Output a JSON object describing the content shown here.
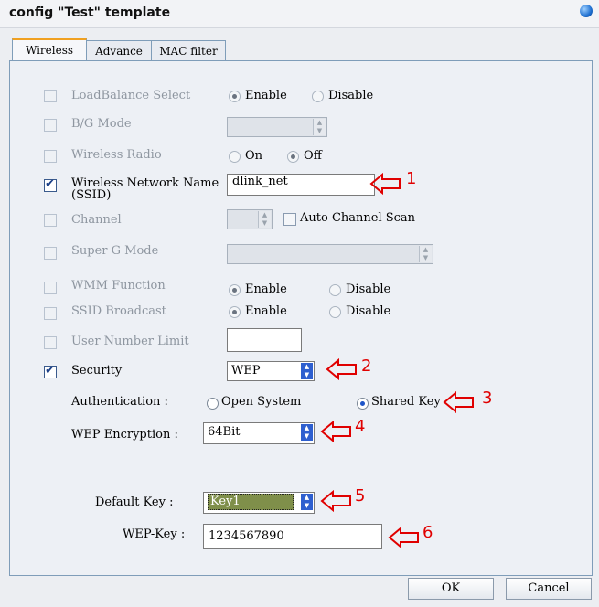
{
  "window": {
    "title": "config \"Test\" template"
  },
  "tabs": [
    "Wireless",
    "Advance",
    "MAC filter"
  ],
  "rows": {
    "load_balance": {
      "label": "LoadBalance Select",
      "opt1": "Enable",
      "opt2": "Disable"
    },
    "bg_mode": {
      "label": "B/G Mode"
    },
    "wireless_radio": {
      "label": "Wireless Radio",
      "opt1": "On",
      "opt2": "Off"
    },
    "ssid": {
      "label_line1": "Wireless Network Name",
      "label_line2": "(SSID)",
      "value": "dlink_net"
    },
    "channel": {
      "label": "Channel",
      "auto_scan": "Auto Channel Scan"
    },
    "super_g": {
      "label": "Super G Mode"
    },
    "wmm": {
      "label": "WMM Function",
      "opt1": "Enable",
      "opt2": "Disable"
    },
    "ssid_broadcast": {
      "label": "SSID Broadcast",
      "opt1": "Enable",
      "opt2": "Disable"
    },
    "user_limit": {
      "label": "User Number Limit",
      "value": ""
    },
    "security": {
      "label": "Security",
      "value": "WEP"
    }
  },
  "auth": {
    "label": "Authentication :",
    "opt1": "Open System",
    "opt2": "Shared Key"
  },
  "wep_encryption": {
    "label": "WEP Encryption :",
    "value": "64Bit"
  },
  "default_key": {
    "label": "Default Key :",
    "value": "Key1"
  },
  "wep_key": {
    "label": "WEP-Key :",
    "value": "1234567890"
  },
  "annotations": [
    "1",
    "2",
    "3",
    "4",
    "5",
    "6"
  ],
  "buttons": {
    "ok": "OK",
    "cancel": "Cancel"
  },
  "colors": {
    "annotation": "#e00000",
    "accent": "#2e5fcf"
  }
}
